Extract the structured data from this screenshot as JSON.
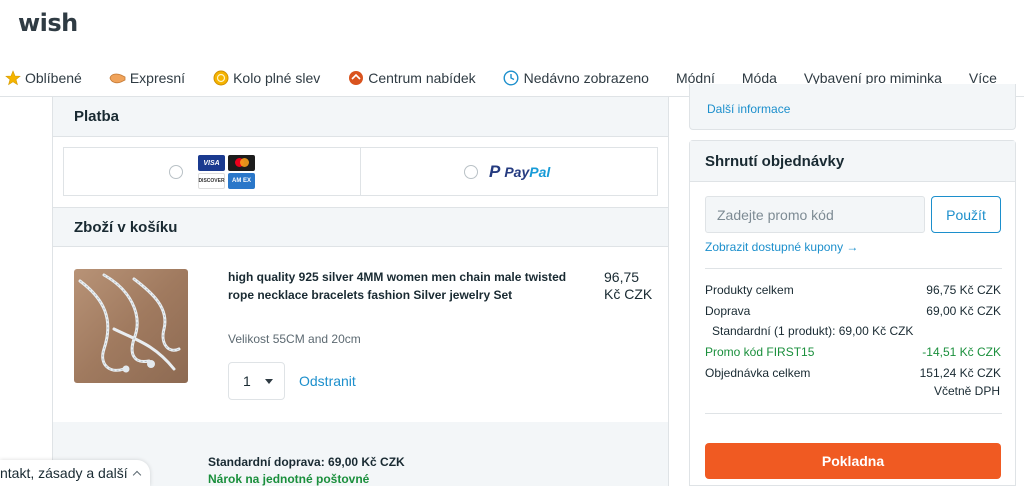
{
  "header": {
    "logo": "wish"
  },
  "nav": {
    "items": [
      {
        "label": "Oblíbené",
        "icon": "star-icon"
      },
      {
        "label": "Expresní",
        "icon": "express-icon"
      },
      {
        "label": "Kolo plné slev",
        "icon": "coin-icon"
      },
      {
        "label": "Centrum nabídek",
        "icon": "deal-icon"
      },
      {
        "label": "Nedávno zobrazeno",
        "icon": "clock-icon"
      },
      {
        "label": "Módní"
      },
      {
        "label": "Móda"
      },
      {
        "label": "Vybavení pro miminka"
      },
      {
        "label": "Více"
      }
    ]
  },
  "payment": {
    "title": "Platba",
    "cards": {
      "visa": "VISA",
      "discover": "DISCOVER",
      "amex": "AM EX"
    },
    "paypal": {
      "part1": "Pay",
      "part2": "Pal"
    }
  },
  "cart": {
    "title": "Zboží v košíku",
    "item": {
      "title": "high quality 925 silver 4MM women men chain male twisted rope necklace bracelets fashion Silver jewelry Set",
      "size": "Velikost 55CM and 20cm",
      "price": "96,75 Kč CZK",
      "quantity": "1",
      "remove_label": "Odstranit"
    },
    "shipping": "Standardní doprava: 69,00 Kč CZK",
    "shipping_note": "Nárok na jednotné poštovné"
  },
  "info": {
    "more_link": "Další informace"
  },
  "summary": {
    "title": "Shrnutí objednávky",
    "promo_placeholder": "Zadejte promo kód",
    "apply_label": "Použít",
    "coupons_link": "Zobrazit dostupné kupony →",
    "rows": {
      "products": {
        "label": "Produkty celkem",
        "value": "96,75 Kč CZK"
      },
      "shipping": {
        "label": "Doprava",
        "value": "69,00 Kč CZK"
      },
      "standard": "Standardní (1 produkt):  69,00 Kč CZK",
      "promo": {
        "label": "Promo kód FIRST15",
        "value": "-14,51 Kč CZK"
      },
      "total": {
        "label": "Objednávka celkem",
        "value": "151,24 Kč CZK"
      }
    },
    "tax_note": "Včetně DPH",
    "checkout_label": "Pokladna"
  },
  "footer": {
    "pill_label": "ntakt, zásady a další"
  },
  "colors": {
    "accent": "#1c8fcc",
    "checkout": "#f05a22",
    "promo": "#1a8f3c"
  }
}
